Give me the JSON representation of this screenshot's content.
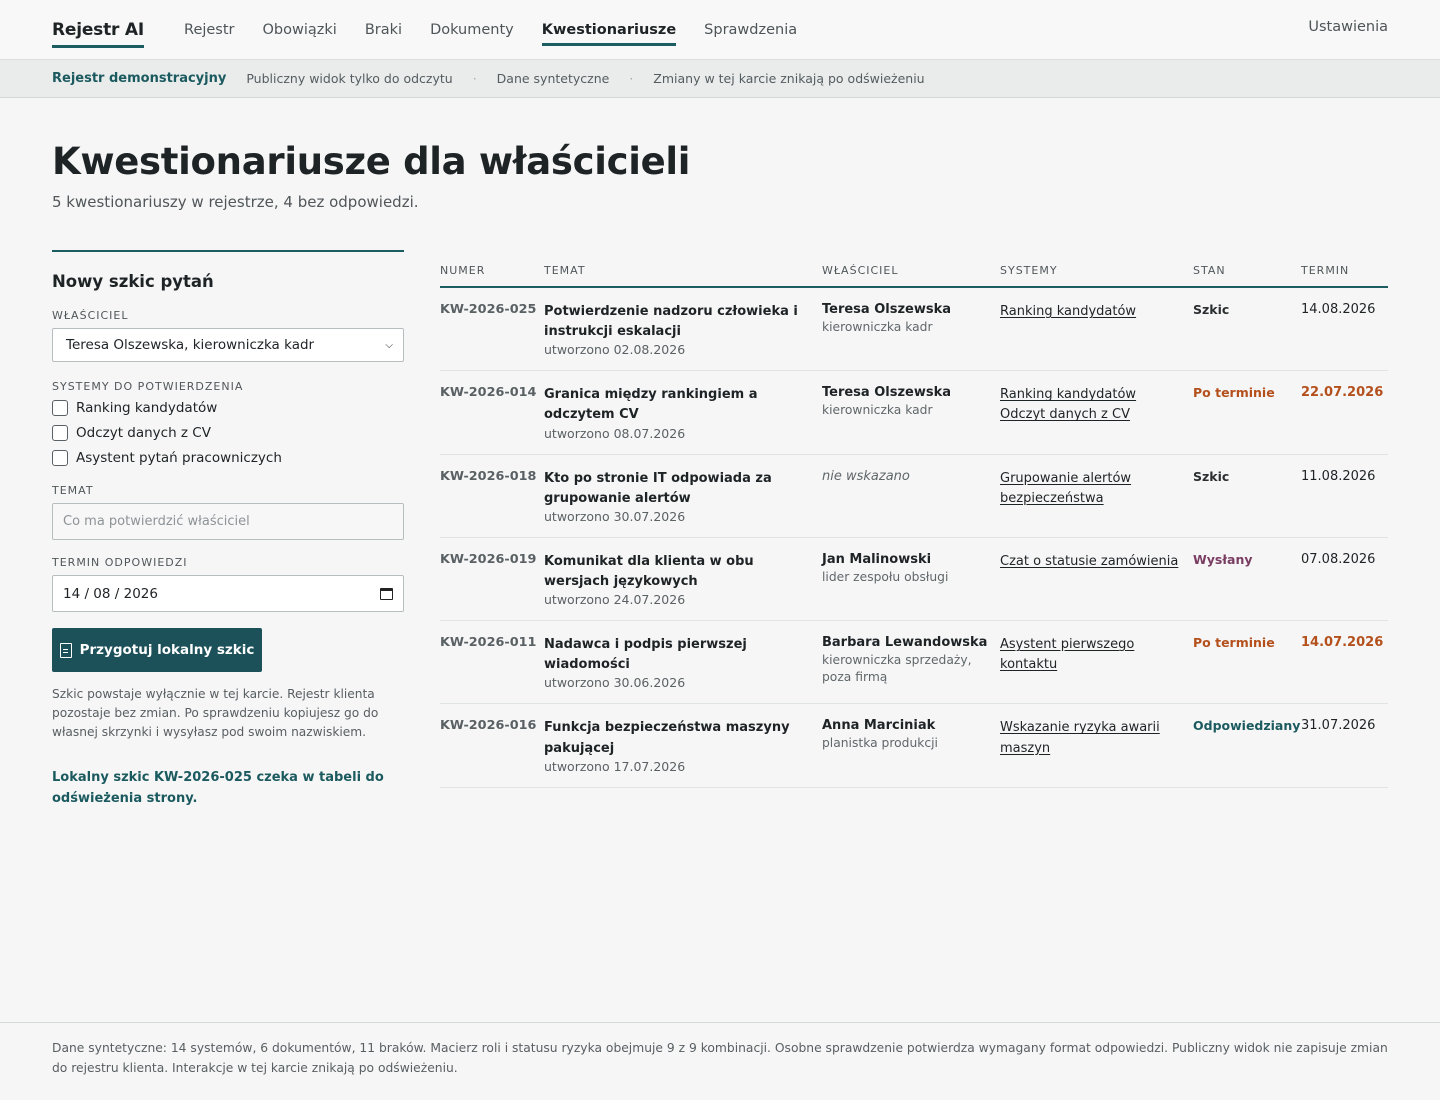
{
  "nav": {
    "brand": "Rejestr AI",
    "links": [
      "Rejestr",
      "Obowiązki",
      "Braki",
      "Dokumenty",
      "Kwestionariusze",
      "Sprawdzenia"
    ],
    "active_index": 4,
    "settings": "Ustawienia"
  },
  "banner": {
    "demo": "Rejestr demonstracyjny",
    "items": [
      "Publiczny widok tylko do odczytu",
      "Dane syntetyczne",
      "Zmiany w tej karcie znikają po odświeżeniu"
    ],
    "separator": "·"
  },
  "page": {
    "title": "Kwestionariusze dla właścicieli",
    "subtitle": "5 kwestionariuszy w rejestrze, 4 bez odpowiedzi."
  },
  "form": {
    "heading": "Nowy szkic pytań",
    "owner_label": "WŁAŚCICIEL",
    "owner_value": "Teresa Olszewska, kierowniczka kadr",
    "systems_label": "SYSTEMY DO POTWIERDZENIA",
    "systems": [
      "Ranking kandydatów",
      "Odczyt danych z CV",
      "Asystent pytań pracowniczych"
    ],
    "topic_label": "TEMAT",
    "topic_placeholder": "Co ma potwierdzić właściciel",
    "deadline_label": "TERMIN ODPOWIEDZI",
    "deadline_value": "14 / 08 / 2026",
    "submit_label": "Przygotuj lokalny szkic",
    "note": "Szkic powstaje wyłącznie w tej karcie. Rejestr klienta pozostaje bez zmian. Po sprawdzeniu kopiujesz go do własnej skrzynki i wysyłasz pod swoim nazwiskiem.",
    "draft_message": "Lokalny szkic KW-2026-025 czeka w tabeli do odświeżenia strony."
  },
  "table": {
    "headers": [
      "NUMER",
      "TEMAT",
      "WŁAŚCICIEL",
      "SYSTEMY",
      "STAN",
      "TERMIN"
    ],
    "rows": [
      {
        "num": "KW-2026-025",
        "topic": "Potwierdzenie nadzoru człowieka i instrukcji eskalacji",
        "created": "utworzono 02.08.2026",
        "owner": "Teresa Olszewska",
        "role": "kierowniczka kadr",
        "systems": [
          "Ranking kandydatów"
        ],
        "status": "Szkic",
        "status_color": "#2b2f31",
        "deadline": "14.08.2026",
        "late": false
      },
      {
        "num": "KW-2026-014",
        "topic": "Granica między rankingiem a odczytem CV",
        "created": "utworzono 08.07.2026",
        "owner": "Teresa Olszewska",
        "role": "kierowniczka kadr",
        "systems": [
          "Ranking kandydatów",
          "Odczyt danych z CV"
        ],
        "status": "Po terminie",
        "status_color": "#b4501c",
        "deadline": "22.07.2026",
        "late": true
      },
      {
        "num": "KW-2026-018",
        "topic": "Kto po stronie IT odpowiada za grupowanie alertów",
        "created": "utworzono 30.07.2026",
        "owner": "",
        "owner_missing": "nie wskazano",
        "role": "",
        "systems": [
          "Grupowanie alertów bezpieczeństwa"
        ],
        "status": "Szkic",
        "status_color": "#2b2f31",
        "deadline": "11.08.2026",
        "late": false
      },
      {
        "num": "KW-2026-019",
        "topic": "Komunikat dla klienta w obu wersjach językowych",
        "created": "utworzono 24.07.2026",
        "owner": "Jan Malinowski",
        "role": "lider zespołu obsługi",
        "systems": [
          "Czat o statusie zamówienia"
        ],
        "status": "Wysłany",
        "status_color": "#7a3d62",
        "deadline": "07.08.2026",
        "late": false
      },
      {
        "num": "KW-2026-011",
        "topic": "Nadawca i podpis pierwszej wiadomości",
        "created": "utworzono 30.06.2026",
        "owner": "Barbara Lewandowska",
        "role": "kierowniczka sprzedaży, poza firmą",
        "systems": [
          "Asystent pierwszego kontaktu"
        ],
        "status": "Po terminie",
        "status_color": "#b4501c",
        "deadline": "14.07.2026",
        "late": true
      },
      {
        "num": "KW-2026-016",
        "topic": "Funkcja bezpieczeństwa maszyny pakującej",
        "created": "utworzono 17.07.2026",
        "owner": "Anna Marciniak",
        "role": "planistka produkcji",
        "systems": [
          "Wskazanie ryzyka awarii maszyn"
        ],
        "status": "Odpowiedziany",
        "status_color": "#1b5a5f",
        "deadline": "31.07.2026",
        "late": false
      }
    ]
  },
  "footer": {
    "text": "Dane syntetyczne: 14 systemów, 6 dokumentów, 11 braków. Macierz roli i statusu ryzyka obejmuje 9 z 9 kombinacji. Osobne sprawdzenie potwierdza wymagany format odpowiedzi. Publiczny widok nie zapisuje zmian do rejestru klienta. Interakcje w tej karcie znikają po odświeżeniu."
  }
}
